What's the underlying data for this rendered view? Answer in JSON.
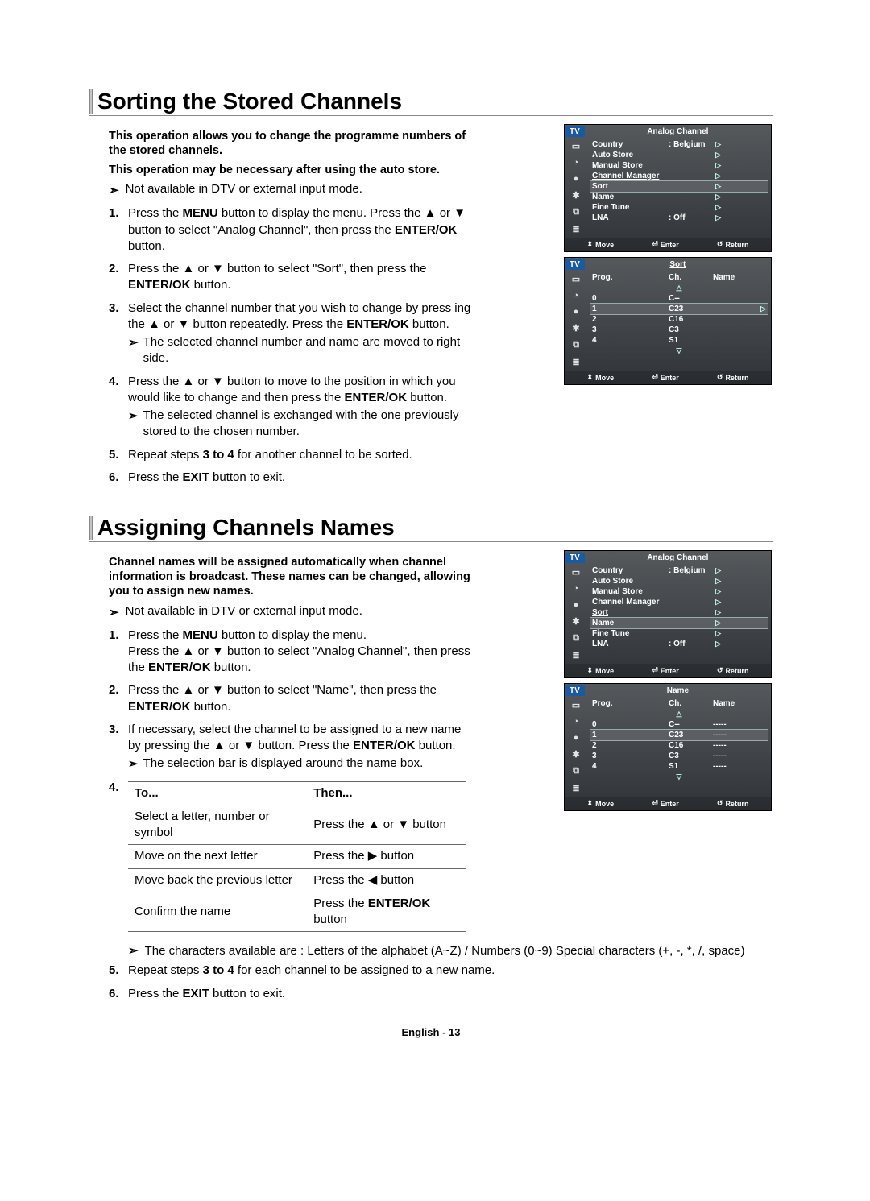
{
  "section1": {
    "heading": "Sorting the Stored Channels",
    "intro1": "This operation allows you to change the programme numbers of the stored channels.",
    "intro2": "This operation may be necessary after using the auto store.",
    "note": "Not available in DTV or external input mode.",
    "steps": {
      "s1a": "Press the ",
      "s1b": "MENU",
      "s1c": " button to display the menu.  Press the ▲ or ▼ button to select \"Analog Channel\", then press the ",
      "s1d": "ENTER/OK",
      "s1e": " button.",
      "s2a": "Press the ▲ or ▼ button to select \"Sort\", then press the ",
      "s2b": "ENTER/OK",
      "s2c": " button.",
      "s3a": "Select the channel number that you wish to change by press ing the ▲ or ▼ button repeatedly. Press the ",
      "s3b": "ENTER/OK",
      "s3c": " button.",
      "s3note": "The selected channel number and name are moved to right side.",
      "s4a": "Press the ▲ or ▼ button to move to the position in which you would like to change and then press the ",
      "s4b": "ENTER/OK",
      "s4c": " button.",
      "s4note": "The selected channel is exchanged with the one previously stored to the chosen number.",
      "s5a": "Repeat steps ",
      "s5b": "3 to 4",
      "s5c": " for another channel to be sorted.",
      "s6a": "Press the ",
      "s6b": "EXIT",
      "s6c": " button to exit."
    }
  },
  "section2": {
    "heading": "Assigning Channels Names",
    "intro": "Channel names will be assigned automatically when channel information is broadcast. These names can be changed, allowing you to assign new names.",
    "note": "Not available in DTV or external input mode.",
    "steps": {
      "s1a": "Press the ",
      "s1b": "MENU",
      "s1c": " button to display the menu.",
      "s1d": "Press the ▲ or ▼ button to select \"Analog Channel\", then press the ",
      "s1e": "ENTER/OK",
      "s1f": " button.",
      "s2a": "Press the ▲ or ▼ button to select \"Name\", then press the ",
      "s2b": "ENTER/OK",
      "s2c": " button.",
      "s3a": "If necessary, select the channel to be assigned to a new name by pressing the ▲ or ▼ button. Press the ",
      "s3b": "ENTER/OK",
      "s3c": " button.",
      "s3note": "The selection bar is displayed around the name box.",
      "table": {
        "h1": "To...",
        "h2": "Then...",
        "r1c1": "Select a letter, number or symbol",
        "r1c2": "Press the ▲ or ▼ button",
        "r2c1": "Move on the next letter",
        "r2c2": "Press the ▶ button",
        "r3c1": "Move back the previous letter",
        "r3c2": "Press the ◀ button",
        "r4c1": "Confirm the name",
        "r4c2a": "Press the ",
        "r4c2b": "ENTER/OK",
        "r4c2c": " button"
      },
      "charnote": "The characters available are : Letters of the alphabet (A~Z) / Numbers (0~9) Special characters (+, -, *, /, space)",
      "s5a": "Repeat steps ",
      "s5b": "3 to 4",
      "s5c": " for each channel to be assigned to a new name.",
      "s6a": "Press the ",
      "s6b": "EXIT",
      "s6c": " button to exit."
    }
  },
  "osd": {
    "tv": "TV",
    "analog_title": "Analog Channel",
    "sort_title": "Sort",
    "name_title": "Name",
    "menu": {
      "country": "Country",
      "country_val": ": Belgium",
      "auto_store": "Auto Store",
      "manual_store": "Manual Store",
      "channel_manager": "Channel Manager",
      "sort": "Sort",
      "name": "Name",
      "fine_tune": "Fine Tune",
      "lna": "LNA",
      "lna_val": ": Off"
    },
    "footer": {
      "move": "Move",
      "enter": "Enter",
      "return": "Return"
    },
    "sort_table": {
      "h1": "Prog.",
      "h2": "Ch.",
      "h3": "Name",
      "r0p": "0",
      "r0c": "C--",
      "r0n": "",
      "r1p": "1",
      "r1c": "C23",
      "r1n": "",
      "r2p": "2",
      "r2c": "C16",
      "r2n": "",
      "r3p": "3",
      "r3c": "C3",
      "r3n": "",
      "r4p": "4",
      "r4c": "S1",
      "r4n": ""
    },
    "name_table": {
      "h1": "Prog.",
      "h2": "Ch.",
      "h3": "Name",
      "r0p": "0",
      "r0c": "C--",
      "r0n": "-----",
      "r1p": "1",
      "r1c": "C23",
      "r1n": "-----",
      "r2p": "2",
      "r2c": "C16",
      "r2n": "-----",
      "r3p": "3",
      "r3c": "C3",
      "r3n": "-----",
      "r4p": "4",
      "r4c": "S1",
      "r4n": "-----"
    }
  },
  "page_num": "English - 13"
}
